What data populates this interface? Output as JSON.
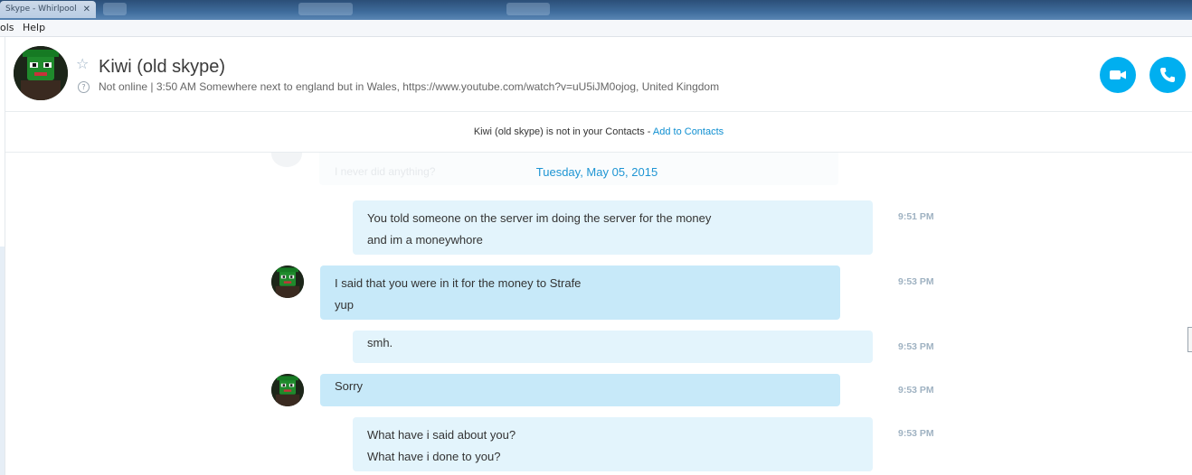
{
  "window": {
    "tab_label": "Skype - Whirlpool",
    "tab_close": "✕"
  },
  "menu": {
    "items": [
      "ols",
      "Help"
    ]
  },
  "header": {
    "contact_name": "Kiwi (old skype)",
    "status": "Not online",
    "separator": "|",
    "mood": "3:50 AM Somewhere next to england but in Wales, https://www.youtube.com/watch?v=uU5iJM0ojog, United Kingdom",
    "favorite_icon": "star-outline-icon",
    "status_icon": "question-icon",
    "video_call_icon": "video-camera-icon",
    "call_icon": "phone-icon",
    "accent_color": "#00aff0"
  },
  "notice": {
    "text": "Kiwi (old skype) is not in your Contacts - ",
    "link": "Add to Contacts"
  },
  "chat": {
    "ghost_text": "I never did anything?",
    "date_separator": "Tuesday, May 05, 2015",
    "messages": [
      {
        "direction": "out",
        "lines": [
          "You told someone on the server im doing the server for the money",
          "and im a moneywhore"
        ],
        "time": "9:51 PM"
      },
      {
        "direction": "in",
        "lines": [
          "I said that you were in it for the money to Strafe",
          "yup"
        ],
        "time": "9:53 PM"
      },
      {
        "direction": "out",
        "lines": [
          "smh."
        ],
        "time": "9:53 PM"
      },
      {
        "direction": "in",
        "lines": [
          "Sorry"
        ],
        "time": "9:53 PM"
      },
      {
        "direction": "out",
        "lines": [
          "What have i said about you?",
          "What have i done to you?"
        ],
        "time": "9:53 PM"
      }
    ]
  }
}
